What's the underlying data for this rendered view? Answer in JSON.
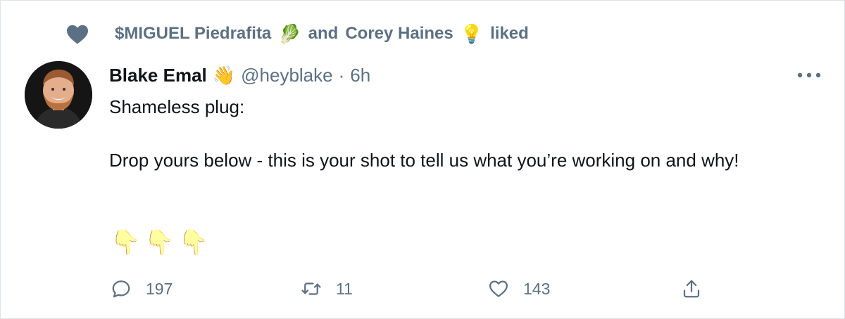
{
  "social_context": {
    "first_user": "$MIGUEL Piedrafita",
    "first_user_emoji": "🥬",
    "conjunction": "and",
    "second_user": "Corey Haines",
    "second_user_emoji": "💡",
    "action": "liked"
  },
  "author": {
    "display_name": "Blake Emal",
    "name_emoji": "👋",
    "handle": "@heyblake",
    "separator": "·",
    "timestamp": "6h"
  },
  "tweet": {
    "line1": "Shameless plug:",
    "line2": "Drop yours below - this is your shot to tell us what you’re working on and why!",
    "pointing_emojis": [
      "👇",
      "👇",
      "👇"
    ]
  },
  "actions": {
    "reply_count": "197",
    "retweet_count": "11",
    "like_count": "143"
  },
  "colors": {
    "secondary_text": "#5b7083",
    "primary_text": "#0f1419",
    "border": "#dde3e8"
  }
}
